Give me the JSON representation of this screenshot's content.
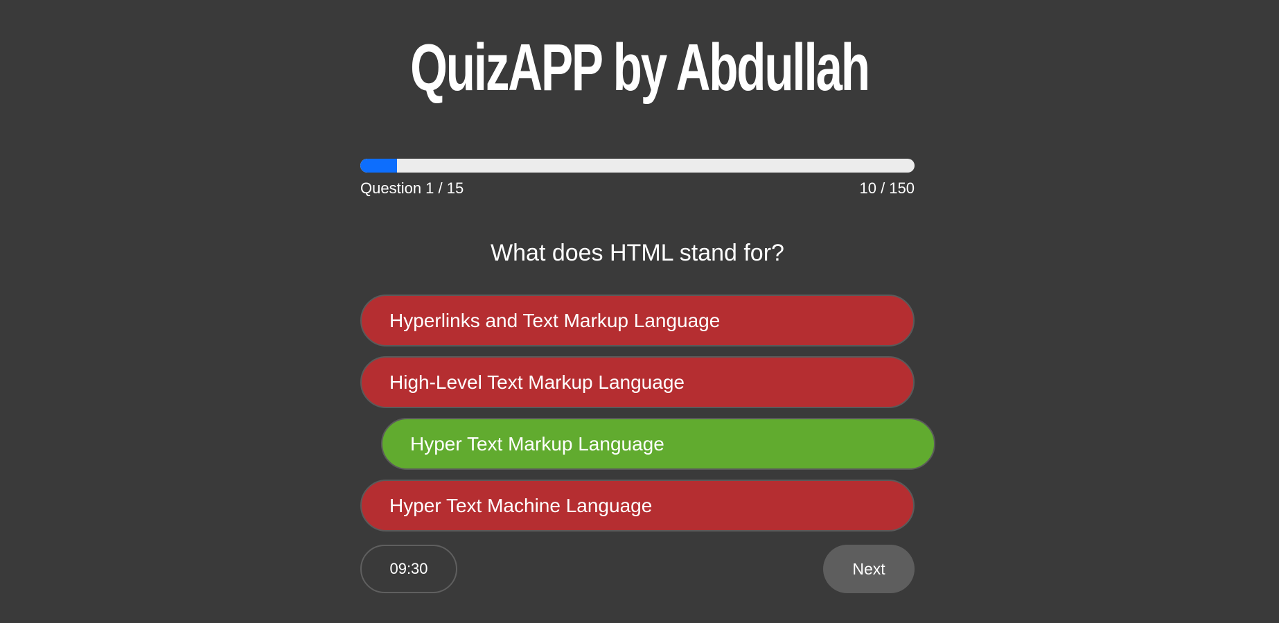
{
  "app": {
    "title": "QuizAPP by Abdullah"
  },
  "progress": {
    "fraction": 0.0667,
    "question_label": "Question 1 / 15",
    "score_label": "10 / 150",
    "fill_color": "#0d6efd",
    "track_color": "#ececec"
  },
  "question": {
    "text": "What does HTML stand for?"
  },
  "options": [
    {
      "label": "Hyperlinks and Text Markup Language",
      "state": "wrong"
    },
    {
      "label": "High-Level Text Markup Language",
      "state": "wrong"
    },
    {
      "label": "Hyper Text Markup Language",
      "state": "correct"
    },
    {
      "label": "Hyper Text Machine Language",
      "state": "wrong"
    }
  ],
  "colors": {
    "background": "#3a3a3a",
    "wrong": "#b52e31",
    "correct": "#61ab2f",
    "next_button": "#5e5e5e"
  },
  "footer": {
    "timer": "09:30",
    "next_label": "Next"
  }
}
